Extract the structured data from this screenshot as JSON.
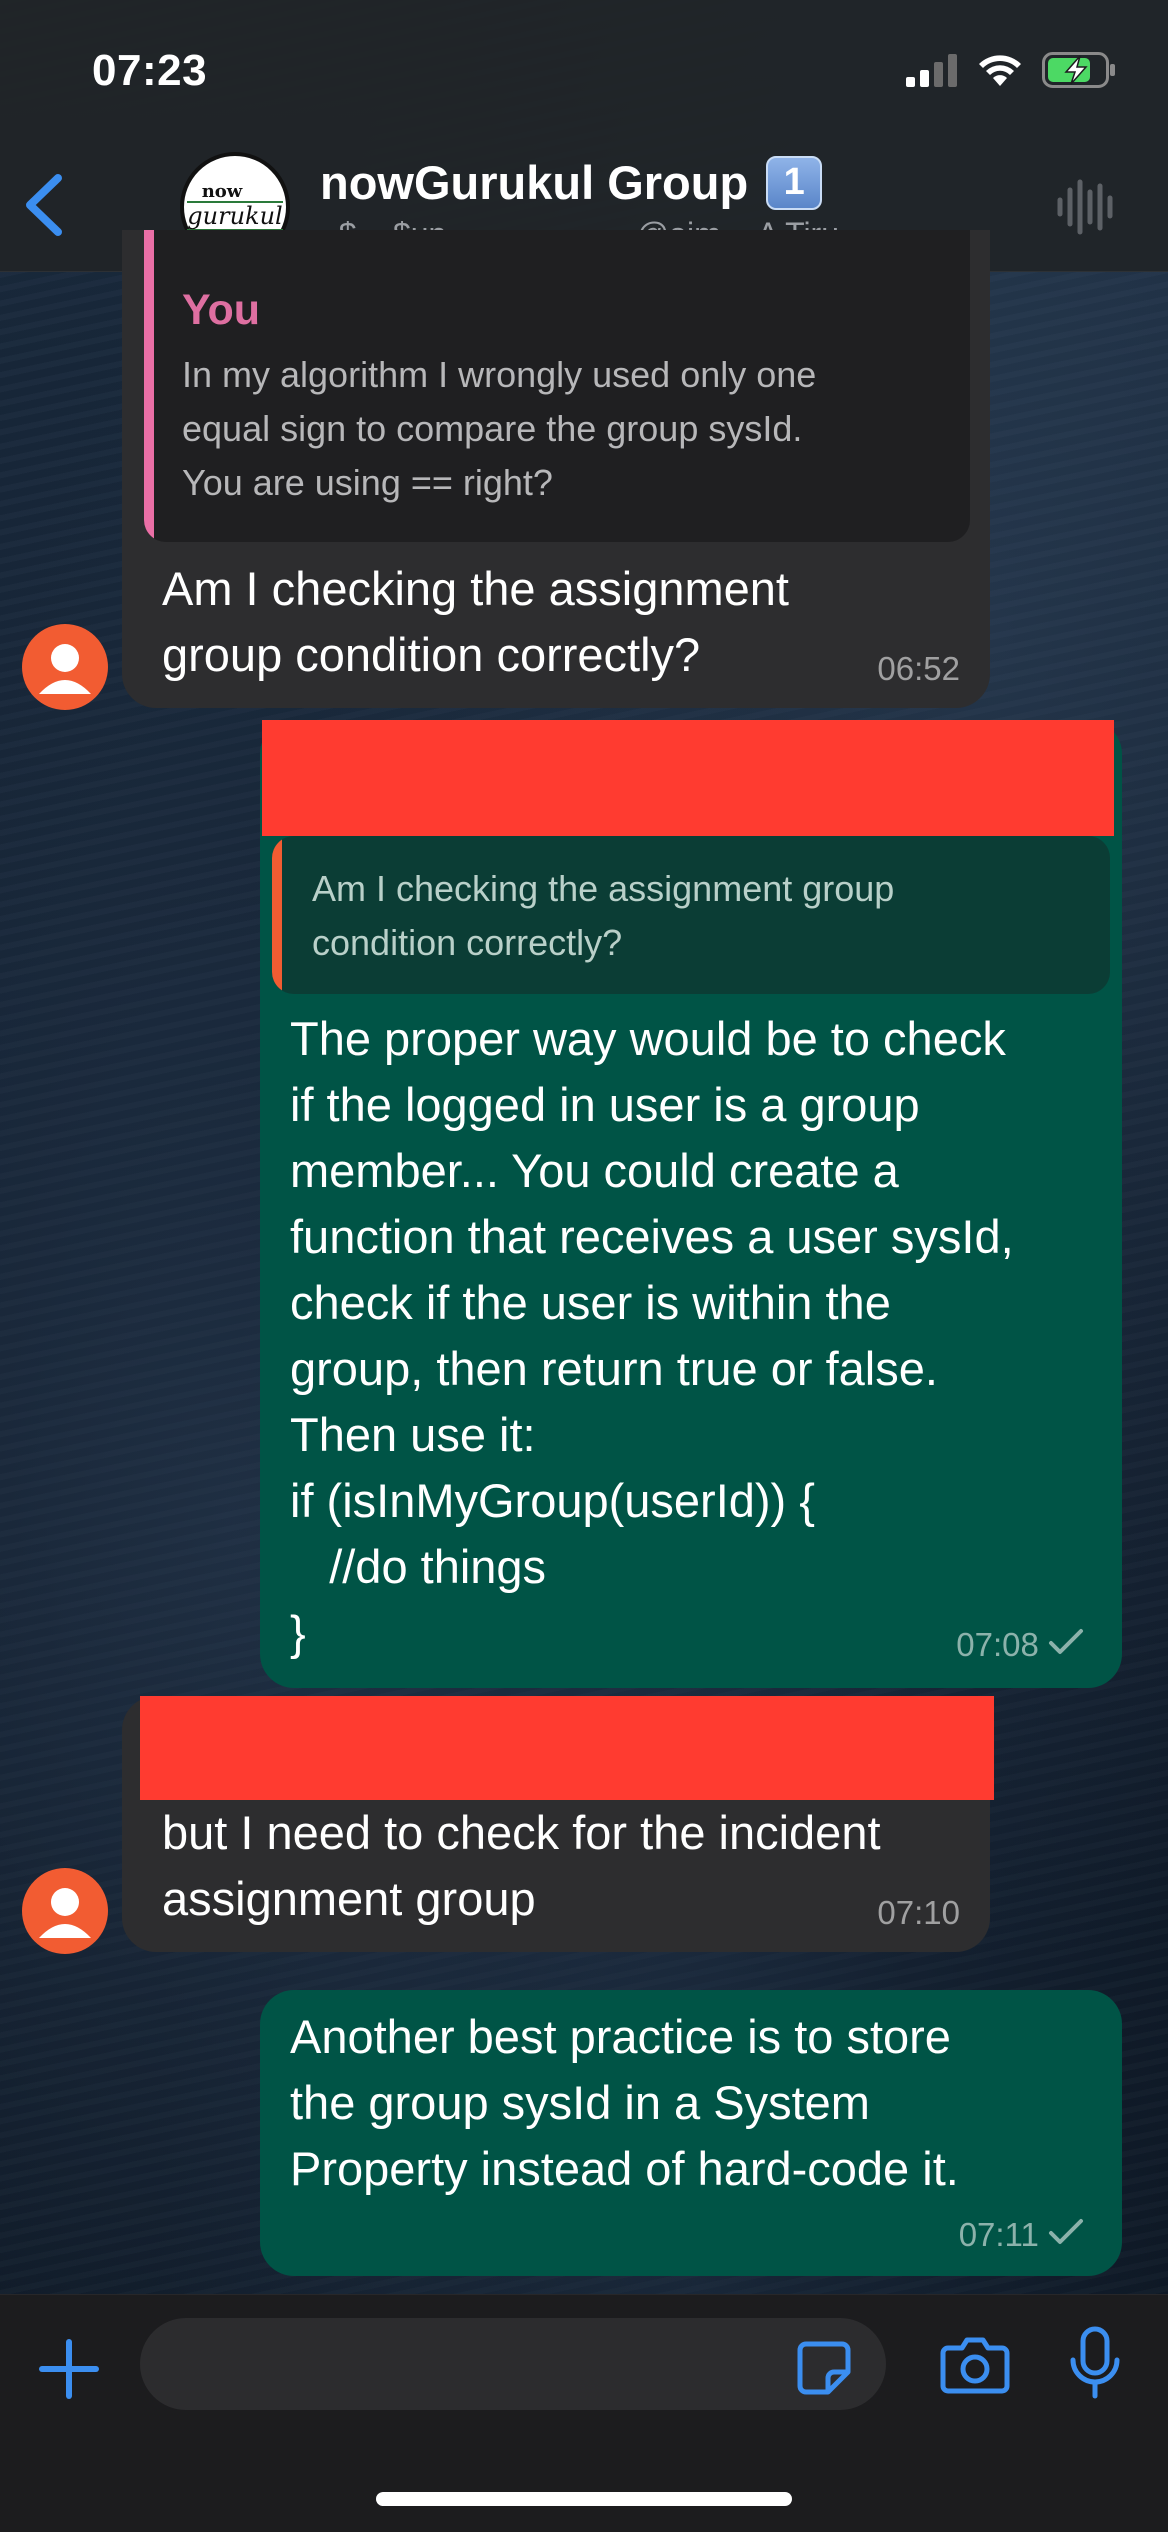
{
  "status_bar": {
    "time": "07:23"
  },
  "header": {
    "group_name": "nowGurukul Group",
    "badge": "1",
    "members": "~$, ~$up, ~., ~., ~..., ~@aim, ~A Tiru...",
    "avatar_word_1": "now",
    "avatar_word_2": "gurukul"
  },
  "messages": [
    {
      "direction": "incoming",
      "quote_author": "You",
      "quote_text": "In my algorithm I wrongly used only one\nequal sign to compare the group sysId.\nYou are using == right?",
      "text": "Am I checking the assignment\ngroup condition correctly?",
      "time": "06:52"
    },
    {
      "direction": "outgoing",
      "quote_text": "Am I checking the assignment group\ncondition correctly?",
      "text": "The proper way would be to check\nif the logged in user is a group\nmember... You could create a\nfunction that receives a user sysId,\ncheck if the user is within the\ngroup, then return true or false.\nThen use it:\nif (isInMyGroup(userId)) {\n   //do things\n}",
      "time": "07:08"
    },
    {
      "direction": "incoming",
      "text": "but I need to check for the incident\nassignment group",
      "time": "07:10"
    },
    {
      "direction": "outgoing",
      "text": "Another best practice is to store\nthe group sysId in a System\nProperty instead of hard-code it.",
      "time": "07:11"
    }
  ],
  "colors": {
    "incoming_bubble": "#2d2d2f",
    "outgoing_bubble": "#005446",
    "accent": "#3b8ef0",
    "redaction": "#ff3b30",
    "quote_author": "#de6fa1"
  },
  "icons": {
    "back": "chevron-left-icon",
    "voice": "waveform-icon",
    "plus": "plus-icon",
    "sticker": "sticker-icon",
    "camera": "camera-icon",
    "mic": "microphone-icon"
  }
}
